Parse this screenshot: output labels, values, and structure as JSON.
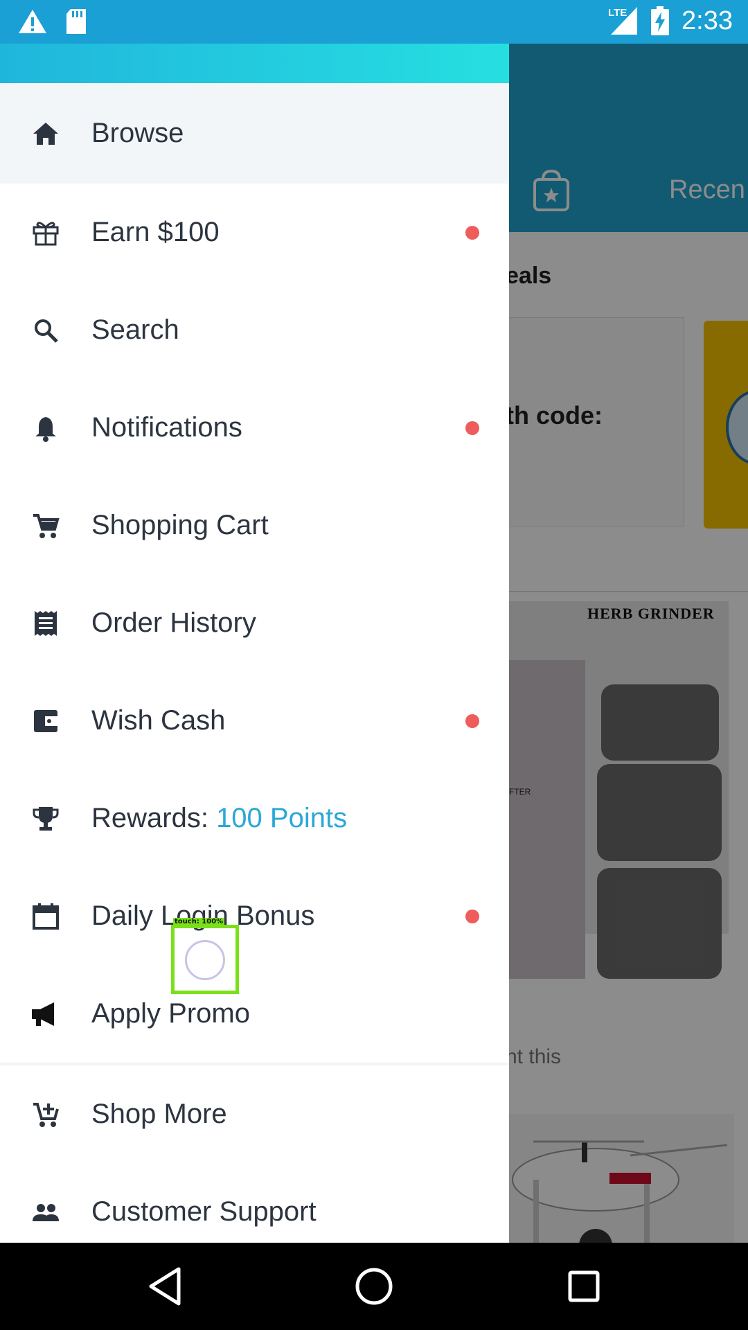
{
  "status_bar": {
    "time": "2:33",
    "network_label": "LTE",
    "icons": [
      "warning-icon",
      "sd-card-icon",
      "lte-signal-icon",
      "battery-charging-icon"
    ]
  },
  "background_app": {
    "header_tab_label": "Recen",
    "section_label": "eals",
    "card_text": "th code:",
    "product_title": "HERB GRINDER",
    "product_badge": "FTER",
    "caption": "ht this"
  },
  "drawer": {
    "items": [
      {
        "label": "Browse",
        "icon": "home-icon",
        "active": true,
        "badge": false
      },
      {
        "label": "Earn $100",
        "icon": "gift-icon",
        "badge": true
      },
      {
        "label": "Search",
        "icon": "search-icon",
        "badge": false
      },
      {
        "label": "Notifications",
        "icon": "bell-icon",
        "badge": true
      },
      {
        "label": "Shopping Cart",
        "icon": "cart-icon",
        "badge": false
      },
      {
        "label": "Order History",
        "icon": "receipt-icon",
        "badge": false
      },
      {
        "label": "Wish Cash",
        "icon": "wallet-icon",
        "badge": true
      },
      {
        "label": "Rewards: ",
        "value": "100 Points",
        "icon": "trophy-icon",
        "badge": false
      },
      {
        "label": "Daily Login Bonus",
        "icon": "calendar-icon",
        "badge": true
      },
      {
        "label": "Apply Promo",
        "icon": "megaphone-icon",
        "badge": false
      },
      {
        "label": "Shop More",
        "icon": "add-cart-icon",
        "badge": false
      },
      {
        "label": "Customer Support",
        "icon": "people-icon",
        "badge": false
      }
    ]
  },
  "touch_indicator": {
    "label": "touch: 100%"
  },
  "colors": {
    "status_bar": "#1aa0d4",
    "drawer_header_start": "#20b6dc",
    "drawer_header_end": "#26dfe1",
    "accent": "#2aa8d6",
    "badge_dot": "#ee5c5c",
    "active_row": "#f3f6f8"
  },
  "nav_bar": {
    "buttons": [
      "back-icon",
      "home-circle-icon",
      "recents-icon"
    ]
  }
}
